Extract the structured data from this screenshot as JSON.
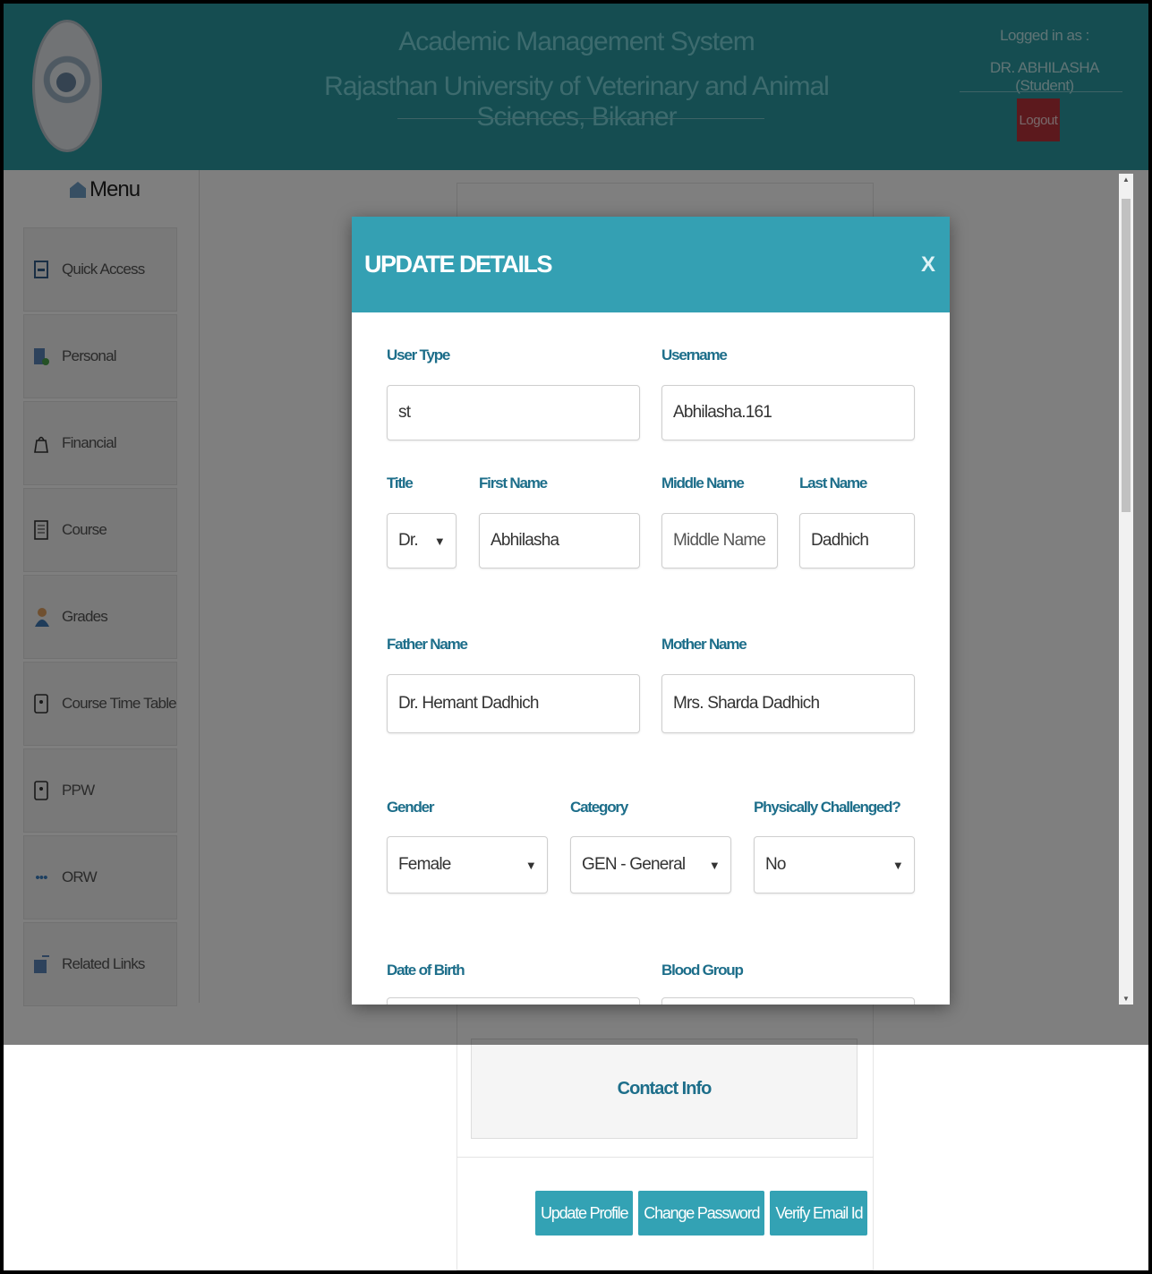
{
  "header": {
    "title_line1": "Academic Management System",
    "title_line2": "Rajasthan University of Veterinary and Animal Sciences, Bikaner",
    "logged_in_label": "Logged in as :",
    "logged_in_user": "DR. ABHILASHA (Student)",
    "logout_label": "Logout"
  },
  "sidebar": {
    "menu_title": "Menu",
    "items": [
      {
        "label": "Quick Access",
        "icon": "quick-access-icon"
      },
      {
        "label": "Personal",
        "icon": "personal-icon"
      },
      {
        "label": "Financial",
        "icon": "financial-icon"
      },
      {
        "label": "Course",
        "icon": "course-icon"
      },
      {
        "label": "Grades",
        "icon": "grades-icon"
      },
      {
        "label": "Course Time Table",
        "icon": "timetable-icon"
      },
      {
        "label": "PPW",
        "icon": "ppw-icon"
      },
      {
        "label": "ORW",
        "icon": "orw-icon"
      },
      {
        "label": "Related Links",
        "icon": "related-links-icon"
      }
    ]
  },
  "main": {
    "contact_info": "Contact Info",
    "buttons": {
      "update_profile": "Update Profile",
      "change_password": "Change Password",
      "verify_email": "Verify Email Id"
    }
  },
  "modal": {
    "title": "UPDATE DETAILS",
    "close": "X",
    "user_type": {
      "label": "User Type",
      "value": "st"
    },
    "username": {
      "label": "Username",
      "value": "Abhilasha.161"
    },
    "title_field": {
      "label": "Title",
      "value": "Dr."
    },
    "first_name": {
      "label": "First Name",
      "value": "Abhilasha"
    },
    "middle_name": {
      "label": "Middle Name",
      "placeholder": "Middle Name"
    },
    "last_name": {
      "label": "Last Name",
      "value": "Dadhich"
    },
    "father_name": {
      "label": "Father Name",
      "value": "Dr. Hemant Dadhich"
    },
    "mother_name": {
      "label": "Mother Name",
      "value": "Mrs. Sharda Dadhich"
    },
    "gender": {
      "label": "Gender",
      "value": "Female"
    },
    "category": {
      "label": "Category",
      "value": "GEN - General"
    },
    "physically_challenged": {
      "label": "Physically Challenged?",
      "value": "No"
    },
    "dob": {
      "label": "Date of Birth"
    },
    "blood_group": {
      "label": "Blood Group"
    }
  },
  "colors": {
    "header_bg": "#2a9aa3",
    "modal_header": "#34a0b3",
    "label_color": "#1d6e8a",
    "logout_bg": "#b8323b",
    "button_bg": "#33a2b4"
  }
}
